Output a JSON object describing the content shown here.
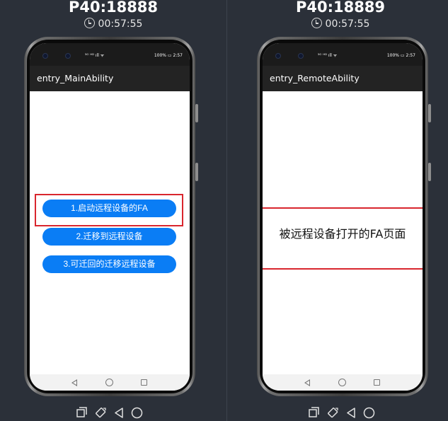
{
  "devices": {
    "left": {
      "title": "P40:18888",
      "timer": "00:57:55",
      "statusbar": {
        "left_icons": "⁵ᴳ ᴴᴰ ıll ᯤ",
        "battery": "100%",
        "time": "2:57"
      },
      "app_title": "entry_MainAbility",
      "buttons": {
        "start_remote_fa": "1.启动远程设备的FA",
        "migrate_to_remote": "2.迁移到远程设备",
        "reversible_migrate": "3.可迁回的迁移远程设备"
      }
    },
    "right": {
      "title": "P40:18889",
      "timer": "00:57:55",
      "statusbar": {
        "left_icons": "⁵ᴳ ᴴᴰ ıll ᯤ",
        "battery": "100%",
        "time": "2:57"
      },
      "app_title": "entry_RemoteAbility",
      "remote_page_text": "被远程设备打开的FA页面"
    }
  },
  "colors": {
    "background": "#2b3039",
    "button_blue": "#0a7df5",
    "highlight_red": "#d9262e",
    "appbar": "#232323"
  },
  "icons": {
    "timer": "stopwatch-icon",
    "toolbar": [
      "screenshot-icon",
      "rotate-icon",
      "back-icon",
      "home-icon"
    ]
  }
}
